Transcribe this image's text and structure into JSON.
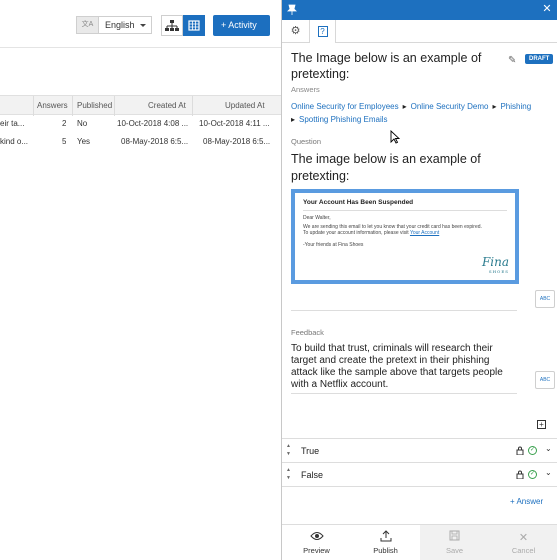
{
  "left": {
    "language": {
      "icon": "translate-icon",
      "icon_text": "文A",
      "selected": "English"
    },
    "activity_label": "+ Activity",
    "table": {
      "headers": [
        "Answers",
        "Published",
        "Created At",
        "Updated At"
      ],
      "rows": [
        {
          "name": "eir ta...",
          "answers": "2",
          "published": "No",
          "created": "10-Oct-2018 4:08 ...",
          "updated": "10-Oct-2018 4:11 ..."
        },
        {
          "name": "kind o...",
          "answers": "5",
          "published": "Yes",
          "created": "08-May-2018 6:5...",
          "updated": "08-May-2018 6:5..."
        }
      ]
    }
  },
  "panel": {
    "accent_color": "#1d70bf",
    "title": "The Image below is an example of pretexting:",
    "subtitle": "Answers",
    "badge": "DRAFT",
    "breadcrumbs": [
      "Online Security for Employees",
      "Online Security Demo",
      "Phishing",
      "Spotting Phishing Emails"
    ],
    "question_label": "Question",
    "question_text": "The image below is an example of pretexting:",
    "email": {
      "heading": "Your Account Has Been Suspended",
      "greeting": "Dear Walter,",
      "line1": "We are sending this email to let you know that your credit card has been expired.",
      "line2": "To update your account information, please visit",
      "link": "Your Account",
      "signoff": "-Your friends at Fina Shoes",
      "logo": "Fina",
      "logo_sub": "SHOES"
    },
    "keyboard_label": "ABC",
    "feedback_label": "Feedback",
    "feedback_text": "To build that trust, criminals will research their target and create the pretext in their phishing attack like the sample above that targets people with a Netflix account.",
    "answers": [
      {
        "label": "True"
      },
      {
        "label": "False"
      }
    ],
    "add_answer": "+ Answer",
    "footer": {
      "preview": "Preview",
      "publish": "Publish",
      "save": "Save",
      "cancel": "Cancel"
    }
  }
}
